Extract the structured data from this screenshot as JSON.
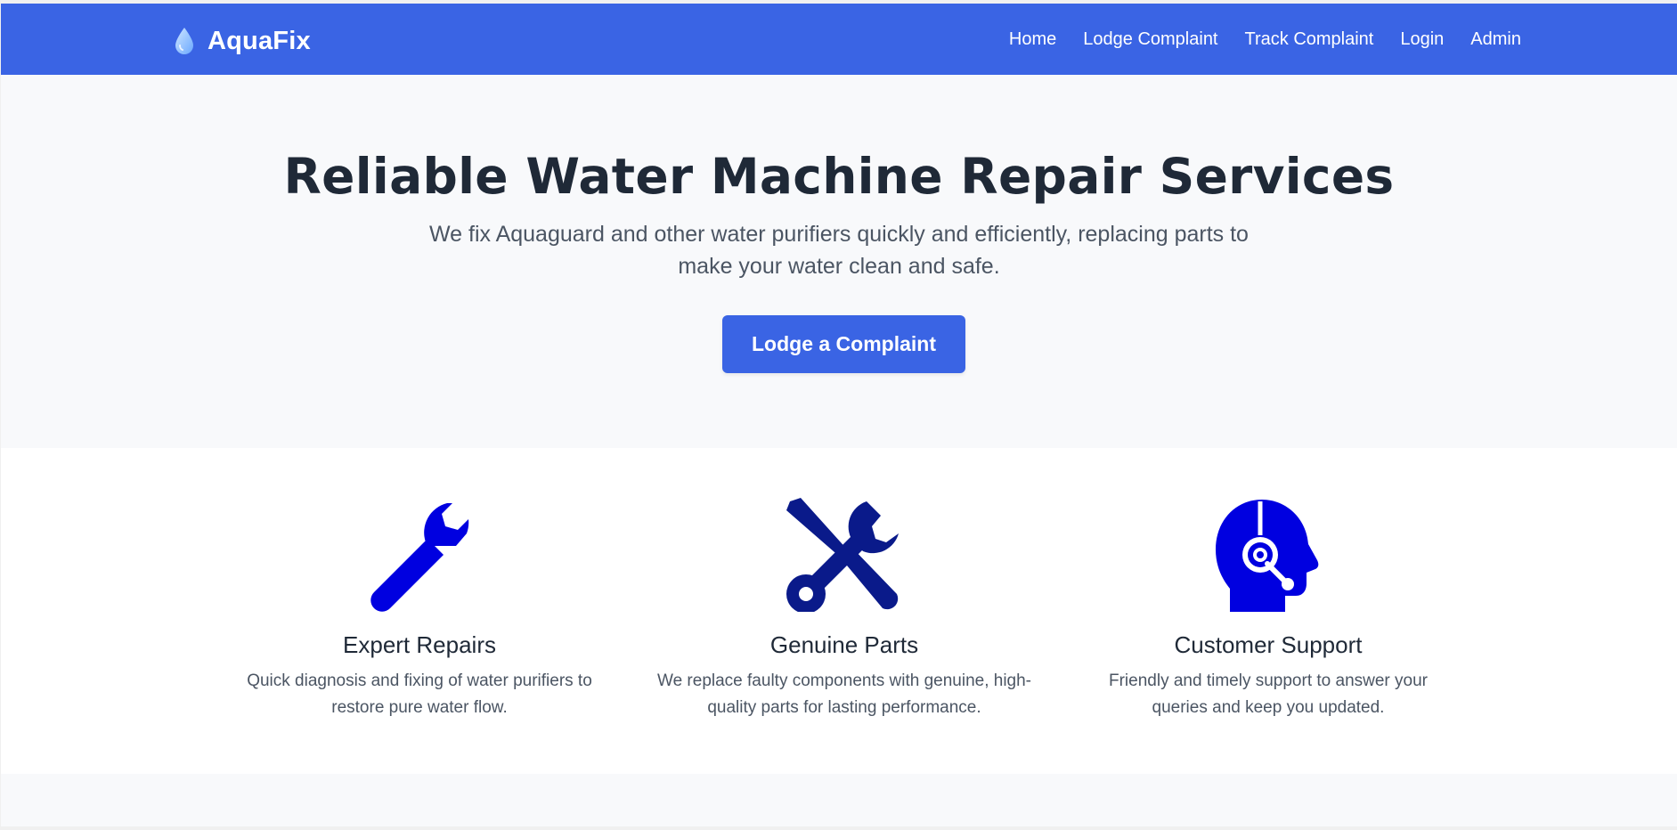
{
  "brand": {
    "name": "AquaFix",
    "icon": "water-drop-icon"
  },
  "nav": {
    "items": [
      "Home",
      "Lodge Complaint",
      "Track Complaint",
      "Login",
      "Admin"
    ]
  },
  "hero": {
    "title": "Reliable Water Machine Repair Services",
    "subtitle": "We fix Aquaguard and other water purifiers quickly and efficiently, replacing parts to make your water clean and safe.",
    "cta_label": "Lodge a Complaint"
  },
  "features": [
    {
      "icon": "wrench-icon",
      "title": "Expert Repairs",
      "description": "Quick diagnosis and fixing of water purifiers to restore pure water flow."
    },
    {
      "icon": "tools-icon",
      "title": "Genuine Parts",
      "description": "We replace faulty components with genuine, high-quality parts for lasting performance."
    },
    {
      "icon": "customer-support-icon",
      "title": "Customer Support",
      "description": "Friendly and timely support to answer your queries and keep you updated."
    }
  ],
  "colors": {
    "primary": "#3a64e4",
    "icon_blue": "#0000e0",
    "icon_navy": "#0a1a8a",
    "heading": "#1f2937",
    "body_text": "#4b5563",
    "page_bg": "#f8f9fb"
  }
}
